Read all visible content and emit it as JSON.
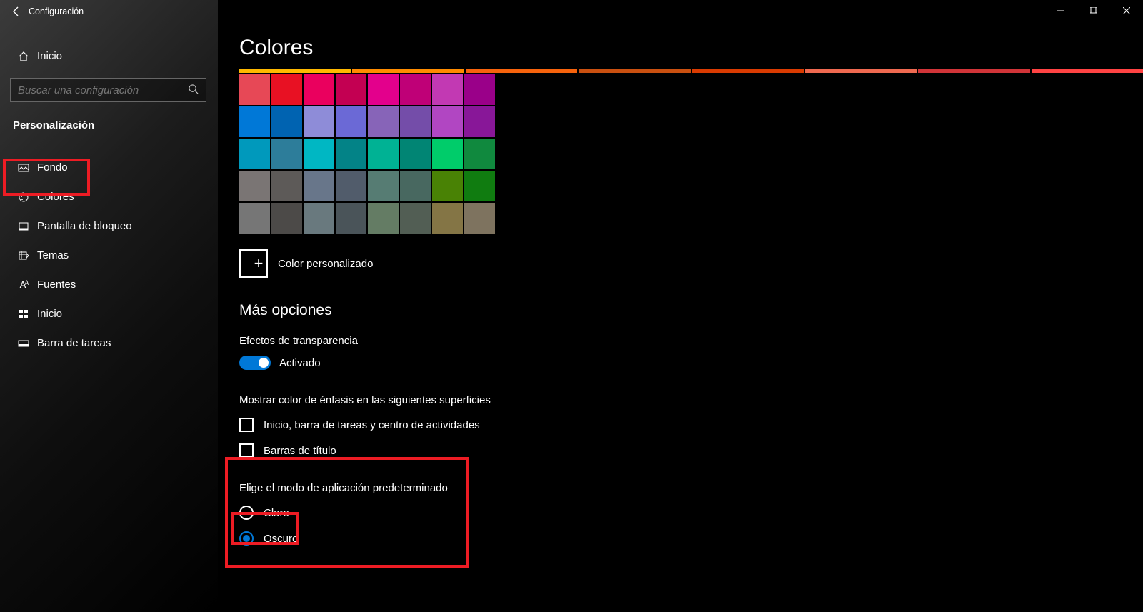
{
  "window": {
    "title": "Configuración"
  },
  "sidebar": {
    "home": "Inicio",
    "search_placeholder": "Buscar una configuración",
    "section": "Personalización",
    "items": [
      {
        "label": "Fondo",
        "icon": "picture-icon"
      },
      {
        "label": "Colores",
        "icon": "palette-icon",
        "selected": true
      },
      {
        "label": "Pantalla de bloqueo",
        "icon": "lock-screen-icon"
      },
      {
        "label": "Temas",
        "icon": "themes-icon"
      },
      {
        "label": "Fuentes",
        "icon": "fonts-icon"
      },
      {
        "label": "Inicio",
        "icon": "start-icon"
      },
      {
        "label": "Barra de tareas",
        "icon": "taskbar-icon"
      }
    ]
  },
  "main": {
    "title": "Colores",
    "accent_strip": [
      "#ffb900",
      "#ff8c00",
      "#f7630c",
      "#ca5010",
      "#da3b01",
      "#ef6950",
      "#d13438",
      "#ff4343"
    ],
    "swatches": [
      [
        "#e74856",
        "#e81123",
        "#ea005e",
        "#c30052",
        "#e3008c",
        "#bf0077",
        "#c239b3",
        "#9a0089"
      ],
      [
        "#0078d7",
        "#0063b1",
        "#8e8cd8",
        "#6b69d6",
        "#8764b8",
        "#744da9",
        "#b146c2",
        "#881798"
      ],
      [
        "#0099bc",
        "#2d7d9a",
        "#00b7c3",
        "#038387",
        "#00b294",
        "#018574",
        "#00cc6a",
        "#10893e"
      ],
      [
        "#7a7574",
        "#5d5a58",
        "#68768a",
        "#515c6b",
        "#567c73",
        "#486860",
        "#498205",
        "#107c10"
      ],
      [
        "#767676",
        "#4c4a48",
        "#69797e",
        "#4a5459",
        "#647c64",
        "#525e54",
        "#847545",
        "#7e735f"
      ]
    ],
    "custom_color": "Color personalizado",
    "more_options": "Más opciones",
    "transparency_label": "Efectos de transparencia",
    "transparency_state": "Activado",
    "accent_surfaces_label": "Mostrar color de énfasis en las siguientes superficies",
    "check_start": "Inicio, barra de tareas y centro de actividades",
    "check_titlebars": "Barras de título",
    "mode_label": "Elige el modo de aplicación predeterminado",
    "mode_light": "Claro",
    "mode_dark": "Oscuro"
  }
}
